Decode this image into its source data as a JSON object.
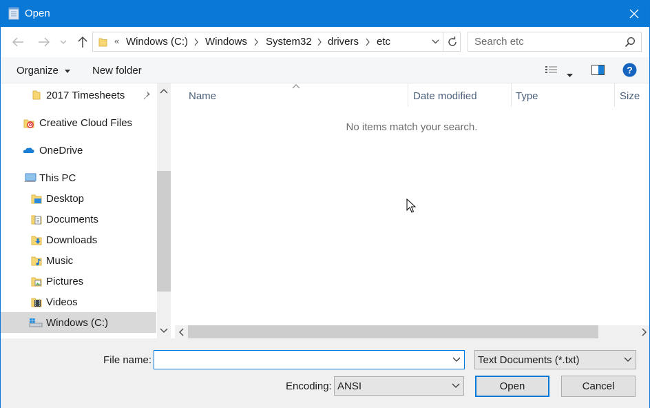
{
  "window": {
    "title": "Open"
  },
  "address": {
    "overflow": "«",
    "crumbs": [
      "Windows (C:)",
      "Windows",
      "System32",
      "drivers",
      "etc"
    ]
  },
  "search": {
    "placeholder": "Search etc",
    "value": ""
  },
  "toolbar": {
    "organize_label": "Organize",
    "new_folder_label": "New folder"
  },
  "nav": {
    "items": [
      {
        "label": "2017 Timesheets",
        "icon": "folder-icon",
        "pinned": true
      },
      {
        "label": "Creative Cloud Files",
        "icon": "creative-cloud-icon"
      },
      {
        "label": "OneDrive",
        "icon": "onedrive-icon"
      },
      {
        "label": "This PC",
        "icon": "this-pc-icon"
      },
      {
        "label": "Desktop",
        "icon": "desktop-folder-icon"
      },
      {
        "label": "Documents",
        "icon": "documents-folder-icon"
      },
      {
        "label": "Downloads",
        "icon": "downloads-folder-icon"
      },
      {
        "label": "Music",
        "icon": "music-folder-icon"
      },
      {
        "label": "Pictures",
        "icon": "pictures-folder-icon"
      },
      {
        "label": "Videos",
        "icon": "videos-folder-icon"
      },
      {
        "label": "Windows (C:)",
        "icon": "windows-drive-icon",
        "selected": true
      }
    ]
  },
  "columns": {
    "name": "Name",
    "date_modified": "Date modified",
    "type": "Type",
    "size": "Size"
  },
  "content": {
    "empty_message": "No items match your search."
  },
  "bottom": {
    "file_name_label": "File name:",
    "file_name_value": "",
    "file_type_value": "Text Documents (*.txt)",
    "encoding_label": "Encoding:",
    "encoding_value": "ANSI",
    "open_label": "Open",
    "cancel_label": "Cancel"
  },
  "colors": {
    "title_bar": "#0a78d7",
    "accent": "#0078d7",
    "selection": "#d9d9d9"
  }
}
